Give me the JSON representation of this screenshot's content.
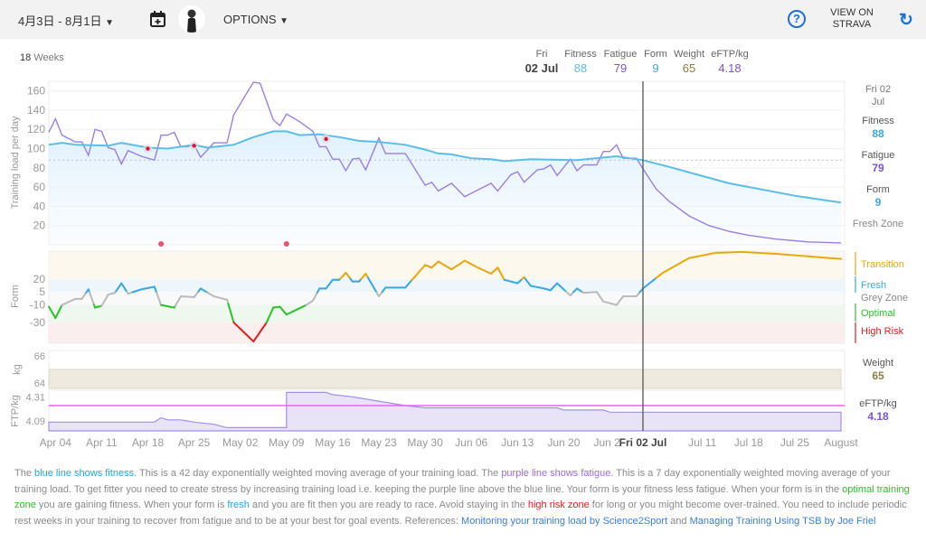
{
  "toolbar": {
    "date_range": "4月3日 - 8月1日",
    "options_label": "OPTIONS",
    "view_on_strava": [
      "VIEW ON",
      "STRAVA"
    ],
    "icons": [
      "calendar-plus-icon",
      "avatar",
      "help-icon",
      "refresh-icon"
    ]
  },
  "summary": {
    "weeks_count": "18",
    "weeks_label": "Weeks"
  },
  "header": {
    "day": "Fri",
    "date": "02 Jul",
    "fitness_label": "Fitness",
    "fitness": "88",
    "fatigue_label": "Fatigue",
    "fatigue": "79",
    "form_label": "Form",
    "form": "9",
    "weight_label": "Weight",
    "weight": "65",
    "eftp_label": "eFTP/kg",
    "eftp": "4.18"
  },
  "side": {
    "date": "Fri 02",
    "date2": "Jul",
    "fitness_label": "Fitness",
    "fitness": "88",
    "fatigue_label": "Fatigue",
    "fatigue": "79",
    "form_label": "Form",
    "form": "9",
    "zone": "Fresh Zone",
    "weight_label": "Weight",
    "weight": "65",
    "eftp_label": "eFTP/kg",
    "eftp": "4.18"
  },
  "zones": [
    {
      "name": "Transition",
      "color": "#e8a90e"
    },
    {
      "name": "Fresh",
      "color": "#3ba8e0"
    },
    {
      "name": "Grey Zone",
      "color": "#999999"
    },
    {
      "name": "Optimal",
      "color": "#2dc22d"
    },
    {
      "name": "High Risk",
      "color": "#e0201f"
    }
  ],
  "colors": {
    "fitness": "#5bbde8",
    "fatigue": "#9b7fe0",
    "eftp": "#a58ee8",
    "eftp_ref": "#f060f0",
    "weight_band": "#eeeae0",
    "marker": "#f0506e",
    "cursor": "#555555"
  },
  "chart_data": [
    {
      "type": "line",
      "ylabel": "Training load per day",
      "yticks": [
        20,
        40,
        60,
        80,
        100,
        120,
        140,
        160
      ],
      "ylim": [
        0,
        170
      ],
      "xlim": [
        "04-03",
        "08-01"
      ],
      "cursor": "07-02",
      "cursor_label": "Fri 02 Jul",
      "xticks": [
        [
          "04-04",
          "Apr 04"
        ],
        [
          "04-11",
          "Apr 11"
        ],
        [
          "04-18",
          "Apr 18"
        ],
        [
          "04-25",
          "Apr 25"
        ],
        [
          "05-02",
          "May 02"
        ],
        [
          "05-09",
          "May 09"
        ],
        [
          "05-16",
          "May 16"
        ],
        [
          "05-23",
          "May 23"
        ],
        [
          "05-30",
          "May 30"
        ],
        [
          "06-06",
          "Jun 06"
        ],
        [
          "06-13",
          "Jun 13"
        ],
        [
          "06-20",
          "Jun 20"
        ],
        [
          "06-27",
          "Jun 27"
        ],
        [
          "07-11",
          "Jul 11"
        ],
        [
          "07-18",
          "Jul 18"
        ],
        [
          "07-25",
          "Jul 25"
        ],
        [
          "08-01",
          "August"
        ]
      ],
      "reference_line": 88,
      "series": [
        {
          "name": "Fitness",
          "points": [
            [
              "04-03",
              104
            ],
            [
              "04-05",
              106
            ],
            [
              "04-07",
              104
            ],
            [
              "04-12",
              103
            ],
            [
              "04-14",
              106
            ],
            [
              "04-18",
              101
            ],
            [
              "04-21",
              100
            ],
            [
              "04-25",
              104
            ],
            [
              "04-27",
              101
            ],
            [
              "05-01",
              104
            ],
            [
              "05-04",
              112
            ],
            [
              "05-07",
              118
            ],
            [
              "05-09",
              118
            ],
            [
              "05-11",
              114
            ],
            [
              "05-14",
              115
            ],
            [
              "05-17",
              112
            ],
            [
              "05-20",
              108
            ],
            [
              "05-23",
              107
            ],
            [
              "05-27",
              104
            ],
            [
              "05-30",
              99
            ],
            [
              "06-01",
              95
            ],
            [
              "06-03",
              94
            ],
            [
              "06-06",
              90
            ],
            [
              "06-09",
              89
            ],
            [
              "06-11",
              87
            ],
            [
              "06-15",
              89
            ],
            [
              "06-22",
              88
            ],
            [
              "06-28",
              92
            ],
            [
              "07-02",
              88
            ],
            [
              "07-06",
              81
            ],
            [
              "07-15",
              64
            ],
            [
              "07-25",
              51
            ],
            [
              "08-01",
              44
            ]
          ]
        },
        {
          "name": "Fatigue",
          "points": [
            [
              "04-03",
              117
            ],
            [
              "04-04",
              131
            ],
            [
              "04-05",
              114
            ],
            [
              "04-07",
              107
            ],
            [
              "04-08",
              107
            ],
            [
              "04-09",
              93
            ],
            [
              "04-10",
              120
            ],
            [
              "04-11",
              118
            ],
            [
              "04-12",
              101
            ],
            [
              "04-13",
              99
            ],
            [
              "04-14",
              84
            ],
            [
              "04-15",
              98
            ],
            [
              "04-17",
              92
            ],
            [
              "04-19",
              88
            ],
            [
              "04-20",
              114
            ],
            [
              "04-21",
              114
            ],
            [
              "04-22",
              117
            ],
            [
              "04-23",
              102
            ],
            [
              "04-24",
              102
            ],
            [
              "04-25",
              104
            ],
            [
              "04-26",
              91
            ],
            [
              "04-28",
              106
            ],
            [
              "04-30",
              106
            ],
            [
              "05-01",
              135
            ],
            [
              "05-03",
              158
            ],
            [
              "05-04",
              169
            ],
            [
              "05-05",
              168
            ],
            [
              "05-07",
              130
            ],
            [
              "05-08",
              124
            ],
            [
              "05-09",
              136
            ],
            [
              "05-11",
              128
            ],
            [
              "05-13",
              118
            ],
            [
              "05-14",
              102
            ],
            [
              "05-15",
              102
            ],
            [
              "05-16",
              89
            ],
            [
              "05-17",
              89
            ],
            [
              "05-18",
              77
            ],
            [
              "05-19",
              89
            ],
            [
              "05-20",
              90
            ],
            [
              "05-21",
              78
            ],
            [
              "05-23",
              111
            ],
            [
              "05-24",
              95
            ],
            [
              "05-27",
              95
            ],
            [
              "05-30",
              62
            ],
            [
              "05-31",
              65
            ],
            [
              "06-01",
              56
            ],
            [
              "06-03",
              64
            ],
            [
              "06-05",
              50
            ],
            [
              "06-07",
              57
            ],
            [
              "06-09",
              64
            ],
            [
              "06-10",
              56
            ],
            [
              "06-12",
              73
            ],
            [
              "06-13",
              76
            ],
            [
              "06-14",
              65
            ],
            [
              "06-16",
              78
            ],
            [
              "06-17",
              79
            ],
            [
              "06-18",
              83
            ],
            [
              "06-19",
              72
            ],
            [
              "06-21",
              89
            ],
            [
              "06-22",
              77
            ],
            [
              "06-23",
              83
            ],
            [
              "06-25",
              83
            ],
            [
              "06-26",
              97
            ],
            [
              "06-27",
              97
            ],
            [
              "06-28",
              104
            ],
            [
              "06-29",
              90
            ],
            [
              "07-01",
              90
            ],
            [
              "07-02",
              79
            ],
            [
              "07-04",
              58
            ],
            [
              "07-06",
              45
            ],
            [
              "07-09",
              30
            ],
            [
              "07-12",
              20
            ],
            [
              "07-15",
              14
            ],
            [
              "07-18",
              10
            ],
            [
              "07-22",
              6
            ],
            [
              "07-27",
              3
            ],
            [
              "08-01",
              2
            ]
          ]
        }
      ],
      "markers": [
        [
          "04-18",
          100
        ],
        [
          "04-25",
          103
        ],
        [
          "05-15",
          110
        ]
      ],
      "bottom_markers": [
        "04-20",
        "05-09"
      ]
    },
    {
      "type": "line",
      "ylabel": "Form",
      "yticks": [
        20,
        5,
        -10,
        -30
      ],
      "ylim": [
        -54,
        52
      ],
      "zone_bounds": [
        20,
        5,
        -10,
        -30
      ],
      "series": [
        {
          "name": "Form",
          "points": [
            [
              "04-03",
              -12
            ],
            [
              "04-04",
              -25
            ],
            [
              "04-05",
              -10
            ],
            [
              "04-07",
              -3
            ],
            [
              "04-08",
              -3
            ],
            [
              "04-09",
              8
            ],
            [
              "04-10",
              -13
            ],
            [
              "04-11",
              -11
            ],
            [
              "04-12",
              2
            ],
            [
              "04-13",
              4
            ],
            [
              "04-14",
              15
            ],
            [
              "04-15",
              3
            ],
            [
              "04-17",
              8
            ],
            [
              "04-19",
              11
            ],
            [
              "04-20",
              -10
            ],
            [
              "04-22",
              -13
            ],
            [
              "04-23",
              0
            ],
            [
              "04-25",
              -1
            ],
            [
              "04-26",
              9
            ],
            [
              "04-28",
              0
            ],
            [
              "04-30",
              -4
            ],
            [
              "05-01",
              -30
            ],
            [
              "05-04",
              -52
            ],
            [
              "05-06",
              -30
            ],
            [
              "05-07",
              -13
            ],
            [
              "05-08",
              -12
            ],
            [
              "05-09",
              -21
            ],
            [
              "05-12",
              -10
            ],
            [
              "05-13",
              -5
            ],
            [
              "05-14",
              9
            ],
            [
              "05-15",
              9
            ],
            [
              "05-16",
              19
            ],
            [
              "05-17",
              19
            ],
            [
              "05-18",
              27
            ],
            [
              "05-19",
              17
            ],
            [
              "05-20",
              17
            ],
            [
              "05-21",
              26
            ],
            [
              "05-23",
              0
            ],
            [
              "05-24",
              10
            ],
            [
              "05-27",
              10
            ],
            [
              "05-30",
              36
            ],
            [
              "05-31",
              33
            ],
            [
              "06-01",
              40
            ],
            [
              "06-03",
              31
            ],
            [
              "06-05",
              41
            ],
            [
              "06-07",
              33
            ],
            [
              "06-09",
              26
            ],
            [
              "06-10",
              33
            ],
            [
              "06-11",
              19
            ],
            [
              "06-13",
              15
            ],
            [
              "06-14",
              22
            ],
            [
              "06-15",
              12
            ],
            [
              "06-17",
              9
            ],
            [
              "06-18",
              7
            ],
            [
              "06-19",
              15
            ],
            [
              "06-21",
              1
            ],
            [
              "06-22",
              9
            ],
            [
              "06-23",
              4
            ],
            [
              "06-25",
              5
            ],
            [
              "06-26",
              -6
            ],
            [
              "06-28",
              -10
            ],
            [
              "06-29",
              0
            ],
            [
              "07-01",
              0
            ],
            [
              "07-02",
              9
            ],
            [
              "07-05",
              27
            ],
            [
              "07-09",
              44
            ],
            [
              "07-13",
              50
            ],
            [
              "07-17",
              51
            ],
            [
              "07-22",
              49
            ],
            [
              "08-01",
              43
            ]
          ]
        }
      ]
    },
    {
      "type": "area",
      "ylabel": "kg",
      "yticks": [
        66,
        64
      ],
      "ylim": [
        63.6,
        66.4
      ],
      "series": [
        {
          "name": "Weight",
          "points": [
            [
              "04-03",
              65
            ],
            [
              "08-01",
              65
            ]
          ]
        }
      ]
    },
    {
      "type": "area",
      "ylabel": "FTP/kg",
      "yticks": [
        4.31,
        4.09
      ],
      "ylim": [
        4.0,
        4.37
      ],
      "reference_line": 4.23,
      "series": [
        {
          "name": "eFTP/kg",
          "points": [
            [
              "04-03",
              4.08
            ],
            [
              "04-19",
              4.08
            ],
            [
              "04-20",
              4.12
            ],
            [
              "04-21",
              4.1
            ],
            [
              "04-23",
              4.1
            ],
            [
              "04-25",
              4.08
            ],
            [
              "04-28",
              4.06
            ],
            [
              "04-30",
              4.03
            ],
            [
              "05-09",
              4.03
            ],
            [
              "05-09",
              4.35
            ],
            [
              "05-15",
              4.35
            ],
            [
              "05-16",
              4.33
            ],
            [
              "05-19",
              4.31
            ],
            [
              "05-20",
              4.3
            ],
            [
              "05-27",
              4.23
            ],
            [
              "05-30",
              4.21
            ],
            [
              "06-19",
              4.21
            ],
            [
              "06-20",
              4.19
            ],
            [
              "06-26",
              4.19
            ],
            [
              "06-27",
              4.17
            ],
            [
              "08-01",
              4.17
            ]
          ]
        }
      ]
    }
  ],
  "explanation": [
    {
      "t": "The ",
      "c": ""
    },
    {
      "t": "blue line shows fitness",
      "c": "#1ea7e1"
    },
    {
      "t": ". This is a 42 day exponentially weighted moving average of your training load. The ",
      "c": ""
    },
    {
      "t": "purple line shows fatigue",
      "c": "#9b6be0"
    },
    {
      "t": ". This is a 7 day exponentially weighted moving average of your training load. To get fitter you need to create stress by increasing training load i.e. keeping the purple line above the blue line. Your form is your fitness less fatigue. When your form is in the ",
      "c": ""
    },
    {
      "t": "optimal training zone",
      "c": "#2dc22d"
    },
    {
      "t": " you are gaining fitness. When your form is ",
      "c": ""
    },
    {
      "t": "fresh",
      "c": "#1ea7e1"
    },
    {
      "t": " and you are fit then you are ready to race. Avoid staying in the ",
      "c": ""
    },
    {
      "t": "high risk zone",
      "c": "#e0201f"
    },
    {
      "t": " for long or you might become over-trained. You need to include periodic rest weeks in your training to recover from fatigue and to be at your best for goal events. References: ",
      "c": ""
    },
    {
      "t": "Monitoring your training load by Science2Sport",
      "c": "#3a7fd5",
      "link": true
    },
    {
      "t": " and ",
      "c": ""
    },
    {
      "t": "Managing Training Using TSB by Joe Friel",
      "c": "#3a7fd5",
      "link": true
    }
  ]
}
